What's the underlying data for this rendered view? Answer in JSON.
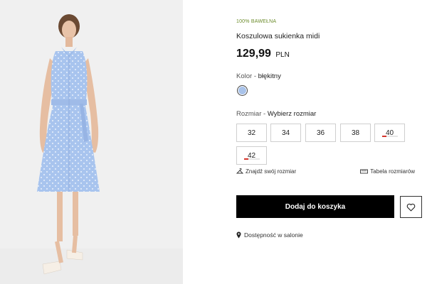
{
  "product": {
    "tag": "100% BAWEŁNA",
    "title": "Koszulowa sukienka midi",
    "price": "129,99",
    "currency": "PLN"
  },
  "color": {
    "label": "Kolor - ",
    "value": "błękitny",
    "swatch_color": "#a9c3ea"
  },
  "size": {
    "label": "Rozmiar - ",
    "value": "Wybierz rozmiar",
    "options": [
      {
        "label": "32",
        "low_stock": false
      },
      {
        "label": "34",
        "low_stock": false
      },
      {
        "label": "36",
        "low_stock": false
      },
      {
        "label": "38",
        "low_stock": false
      },
      {
        "label": "40",
        "low_stock": true
      },
      {
        "label": "42",
        "low_stock": true
      }
    ]
  },
  "links": {
    "find_size": "Znajdź swój rozmiar",
    "size_chart": "Tabela rozmiarów"
  },
  "actions": {
    "add_to_cart": "Dodaj do koszyka"
  },
  "availability": {
    "label": "Dostępność w salonie"
  },
  "colors": {
    "accent_button": "#000000",
    "tag_color": "#6b8b2a",
    "low_stock_bar": "#d4342b"
  }
}
